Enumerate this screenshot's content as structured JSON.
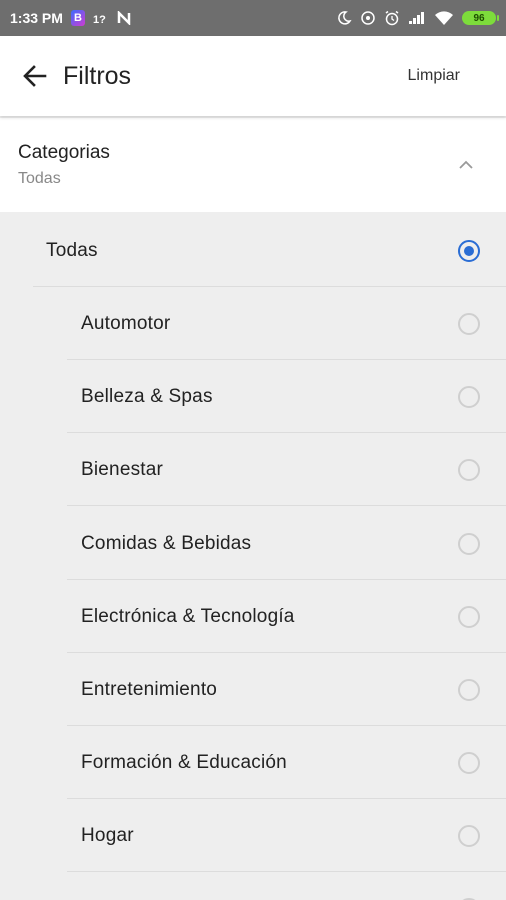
{
  "status_bar": {
    "time": "1:33 PM",
    "badge": "B",
    "icons_left": [
      "notification-b-icon",
      "data-icon",
      "n-icon"
    ],
    "icons_right": [
      "moon-icon",
      "sync-icon",
      "alarm-icon",
      "signal-icon",
      "wifi-icon",
      "battery-icon"
    ],
    "signal_text": "1?",
    "battery_level": "96"
  },
  "app_bar": {
    "title": "Filtros",
    "clear_label": "Limpiar"
  },
  "category": {
    "title": "Categorias",
    "selected_value": "Todas"
  },
  "options": [
    {
      "label": "Todas",
      "selected": true
    },
    {
      "label": "Automotor",
      "selected": false
    },
    {
      "label": "Belleza & Spas",
      "selected": false
    },
    {
      "label": "Bienestar",
      "selected": false
    },
    {
      "label": "Comidas & Bebidas",
      "selected": false
    },
    {
      "label": "Electrónica & Tecnología",
      "selected": false
    },
    {
      "label": "Entretenimiento",
      "selected": false
    },
    {
      "label": "Formación & Educación",
      "selected": false
    },
    {
      "label": "Hogar",
      "selected": false
    }
  ],
  "colors": {
    "accent": "#2a6dd4",
    "status_bar": "#6e6e6e",
    "list_bg": "#eeeeee"
  }
}
